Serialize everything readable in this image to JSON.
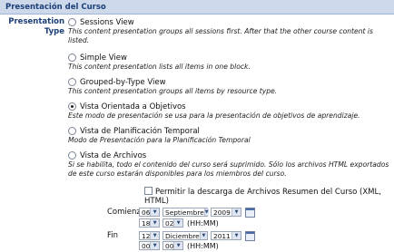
{
  "section": {
    "title": "Presentación del Curso"
  },
  "field": {
    "label_line1": "Presentation",
    "label_line2": "Type"
  },
  "options": [
    {
      "title": "Sessions View",
      "desc": "This content presentation groups all sessions first. After that the other course content is listed.",
      "checked": false
    },
    {
      "title": "Simple View",
      "desc": "This content presentation lists all items in one block.",
      "checked": false
    },
    {
      "title": "Grouped-by-Type View",
      "desc": "This content presentation groups all items by resource type.",
      "checked": false
    },
    {
      "title": "Vista Orientada a Objetivos",
      "desc": "Este modo de presentación se usa para la presentación de objetivos de aprendizaje.",
      "checked": true
    },
    {
      "title": "Vista de Planificación Temporal",
      "desc": "Modo de Presentación para la Planificación Temporal",
      "checked": false
    },
    {
      "title": "Vista de Archivos",
      "desc": "Si se habilita, todo el contenido del curso será suprimido. Sólo los archivos HTML exportados de este curso estarán disponibles para los miembros del curso.",
      "checked": false
    }
  ],
  "download": {
    "label": "Permitir la descarga de Archivos Resumen del Curso (XML, HTML)",
    "checked": false
  },
  "start": {
    "label": "Comienzo",
    "day": "06",
    "month": "Septiembre",
    "year": "2009",
    "hour": "18",
    "minute": "02",
    "format": "(HH:MM)"
  },
  "end": {
    "label": "Fin",
    "day": "12",
    "month": "Diciembre",
    "year": "2011",
    "hour": "00",
    "minute": "00",
    "format": "(HH:MM)"
  },
  "icons": {
    "calendar": "calendar-icon",
    "dropdown": "chevron-down-icon"
  }
}
